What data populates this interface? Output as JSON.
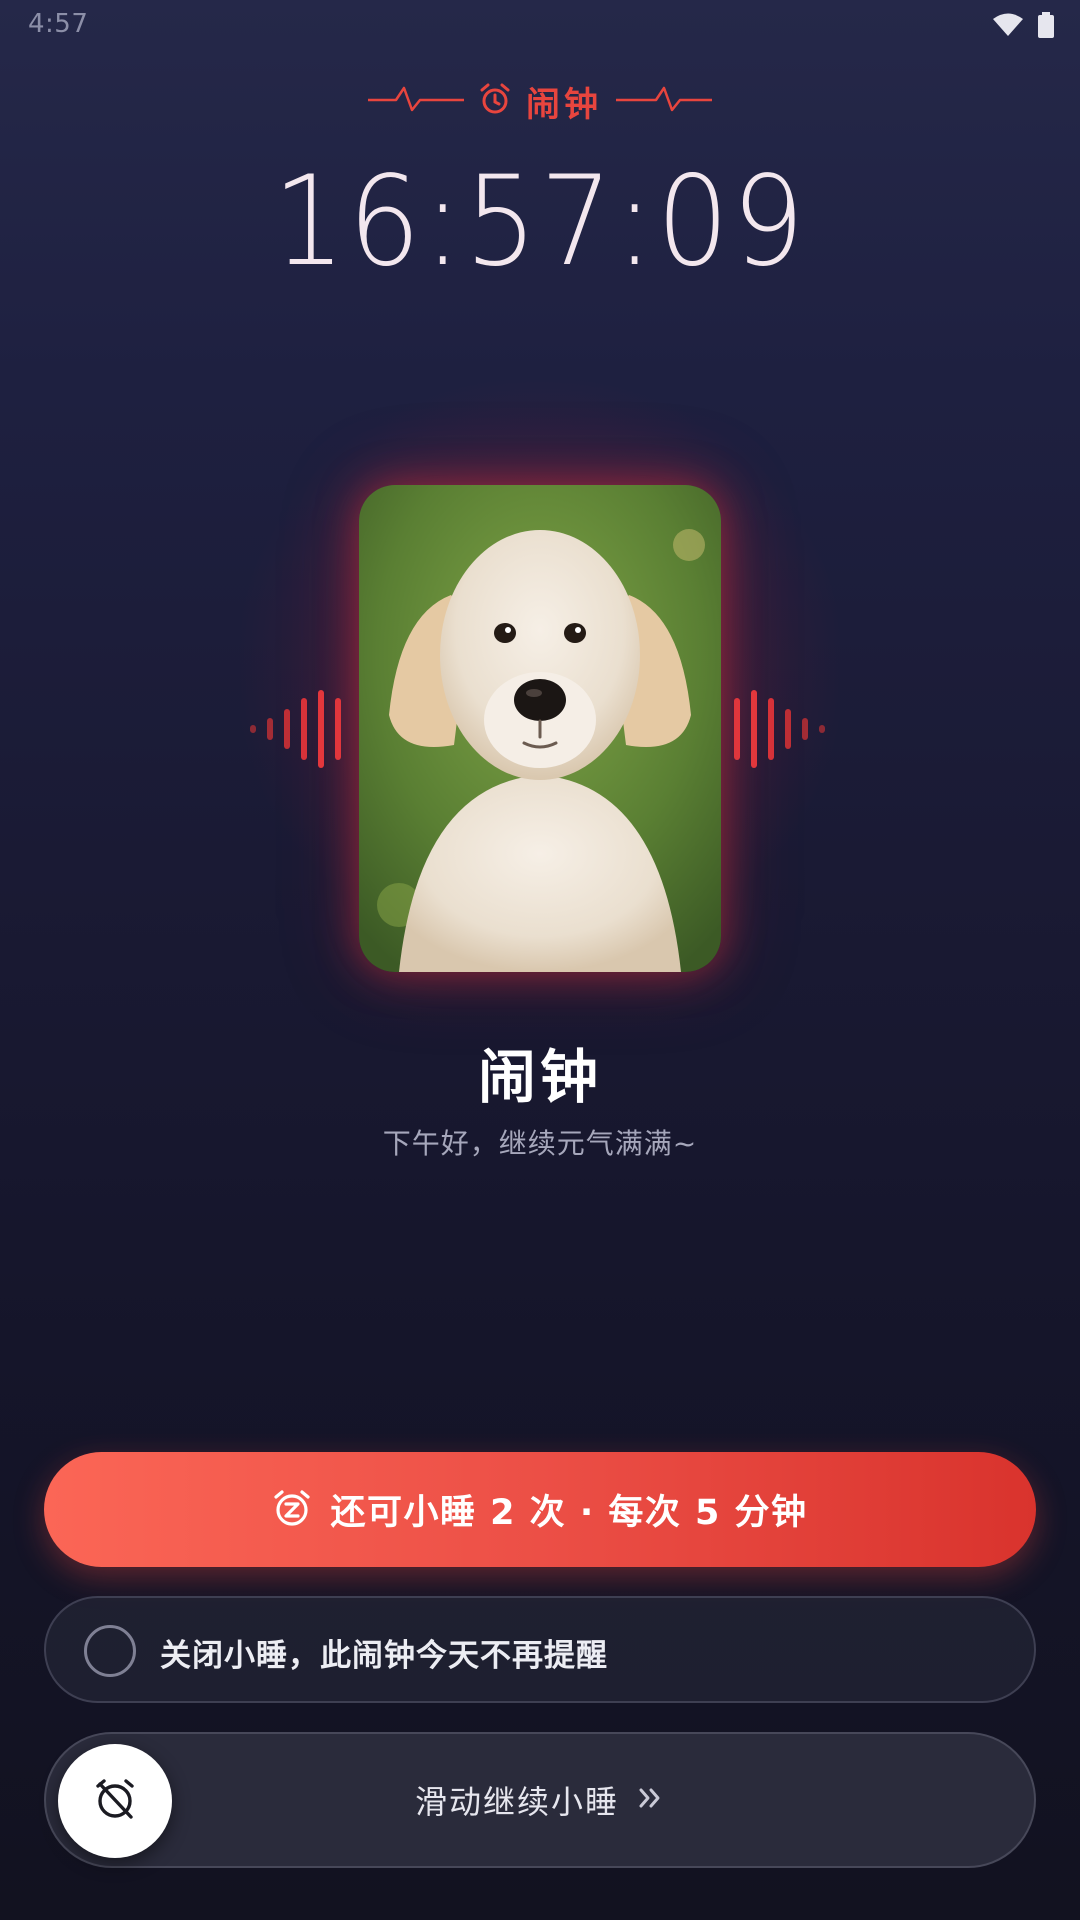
{
  "status_bar": {
    "time": "4:57",
    "icons": [
      "wifi-icon",
      "battery-icon"
    ]
  },
  "header": {
    "title": "闹钟",
    "icon": "alarm-clock-icon",
    "accent_color": "#e8453e"
  },
  "clock": {
    "time": "16:57:09"
  },
  "alarm": {
    "image": "golden retriever puppy photo",
    "name": "闹钟",
    "greeting": "下午好，继续元气满满~"
  },
  "actions": {
    "snooze_label": "还可小睡 2 次 · 每次 5 分钟",
    "snooze_icon": "snooze-alarm-icon",
    "dismiss_label": "关闭小睡，此闹钟今天不再提醒",
    "slide_label": "滑动继续小睡",
    "slide_handle_icon": "alarm-off-icon",
    "slide_arrow_icon": "double-chevron-right-icon"
  },
  "colors": {
    "snooze_gradient_start": "#fb6656",
    "snooze_gradient_end": "#d9332d"
  }
}
